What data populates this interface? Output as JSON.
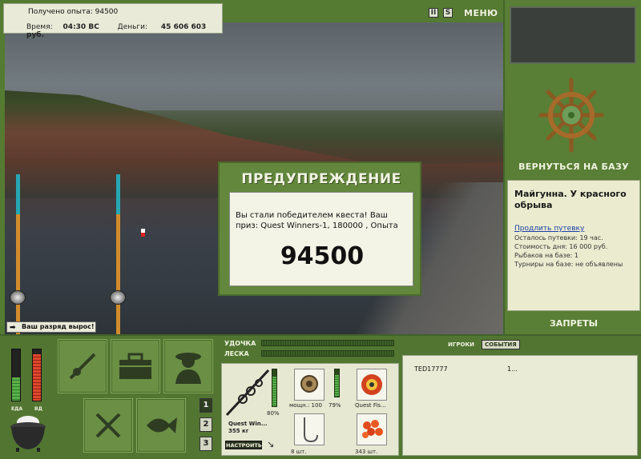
{
  "stats": {
    "xp_label": "Получено опыта:",
    "xp_value": "94500",
    "time_label": "Время:",
    "time_value": "04:30 ВС",
    "money_label": "Деньги:",
    "money_value": "45 606 603 руб."
  },
  "topbar": {
    "pause_icon": "pause-icon",
    "settings_icon_glyph": "S",
    "menu_label": "МЕНЮ"
  },
  "dialog": {
    "title": "ПРЕДУПРЕЖДЕНИЕ",
    "message": "Вы стали победителем квеста! Ваш приз: Quest Winners-1, 180000 , Опыта",
    "big_value": "94500"
  },
  "toast": {
    "text": "Ваш разряд вырос!"
  },
  "right_panel": {
    "return_label": "ВЕРНУТЬСЯ НА БАЗУ",
    "location_title": "Майгунна. У красного обрыва",
    "extend_link": "Продлить путевку",
    "lines": [
      "Осталось путевки: 19 час.",
      "Стоимость дня: 16 000 руб.",
      "Рыбаков на базе: 1",
      "Турниры на базе: не объявлены"
    ],
    "bans_label": "ЗАПРЕТЫ"
  },
  "status": {
    "food_label": "ЕДА",
    "vd_label": "ВД",
    "food_level": 0.45,
    "vd_level": 0.9
  },
  "hotbar": {
    "pages": [
      "1",
      "2",
      "3"
    ]
  },
  "tackle": {
    "rod_label": "УДОЧКА",
    "line_label": "ЛЕСКА",
    "rod_name": "Quest Win...",
    "rod_weight": "355 кг",
    "rod_percent": "80%",
    "reel_power": "мощн.: 100",
    "reel_percent": "79%",
    "line_name": "Quest Fis...",
    "hooks_count": "8 шт.",
    "bait_count": "343 шт.",
    "setup_label": "НАСТРОИТЬ"
  },
  "social": {
    "tabs": [
      "ИГРОКИ",
      "СОБЫТИЯ"
    ],
    "active_tab": "СОБЫТИЯ",
    "players": [
      {
        "name": "TED17777",
        "value": "1..."
      }
    ]
  },
  "colors": {
    "panel_green": "#557a32",
    "dialog_green": "#63873c",
    "cream": "#e9ead8"
  }
}
